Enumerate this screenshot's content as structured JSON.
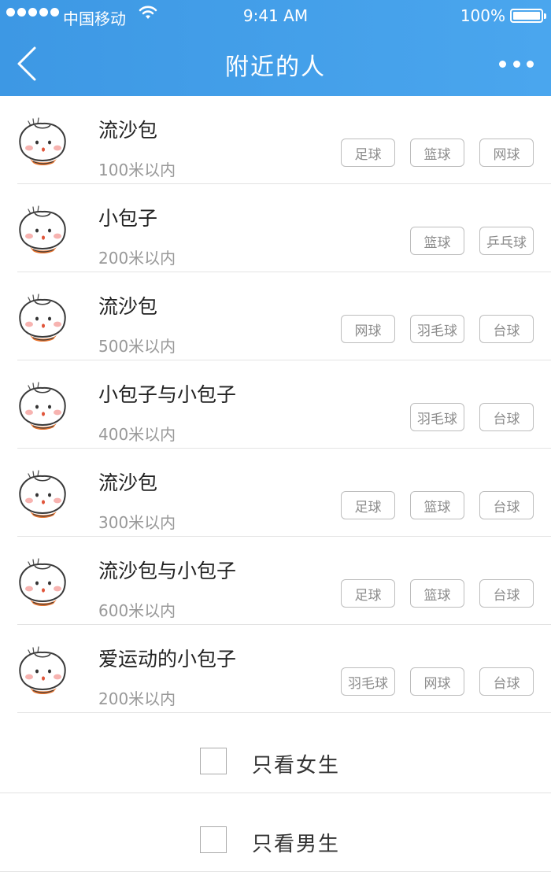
{
  "status_bar": {
    "carrier": "中国移动",
    "time": "9:41 AM",
    "battery": "100%"
  },
  "header": {
    "title": "附近的人",
    "back_icon": "chevron-left-icon",
    "more_icon": "more-dots-icon",
    "bg_color": "#4aa6ee"
  },
  "people": [
    {
      "name": "流沙包",
      "distance": "100米以内",
      "tags": [
        "足球",
        "篮球",
        "网球"
      ]
    },
    {
      "name": "小包子",
      "distance": "200米以内",
      "tags": [
        "篮球",
        "乒乓球"
      ]
    },
    {
      "name": "流沙包",
      "distance": "500米以内",
      "tags": [
        "网球",
        "羽毛球",
        "台球"
      ]
    },
    {
      "name": "小包子与小包子",
      "distance": "400米以内",
      "tags": [
        "羽毛球",
        "台球"
      ]
    },
    {
      "name": "流沙包",
      "distance": "300米以内",
      "tags": [
        "足球",
        "篮球",
        "台球"
      ]
    },
    {
      "name": "流沙包与小包子",
      "distance": "600米以内",
      "tags": [
        "足球",
        "篮球",
        "台球"
      ]
    },
    {
      "name": "爱运动的小包子",
      "distance": "200米以内",
      "tags": [
        "羽毛球",
        "网球",
        "台球"
      ]
    }
  ],
  "filters": [
    {
      "label": "只看女生"
    },
    {
      "label": "只看男生"
    }
  ]
}
